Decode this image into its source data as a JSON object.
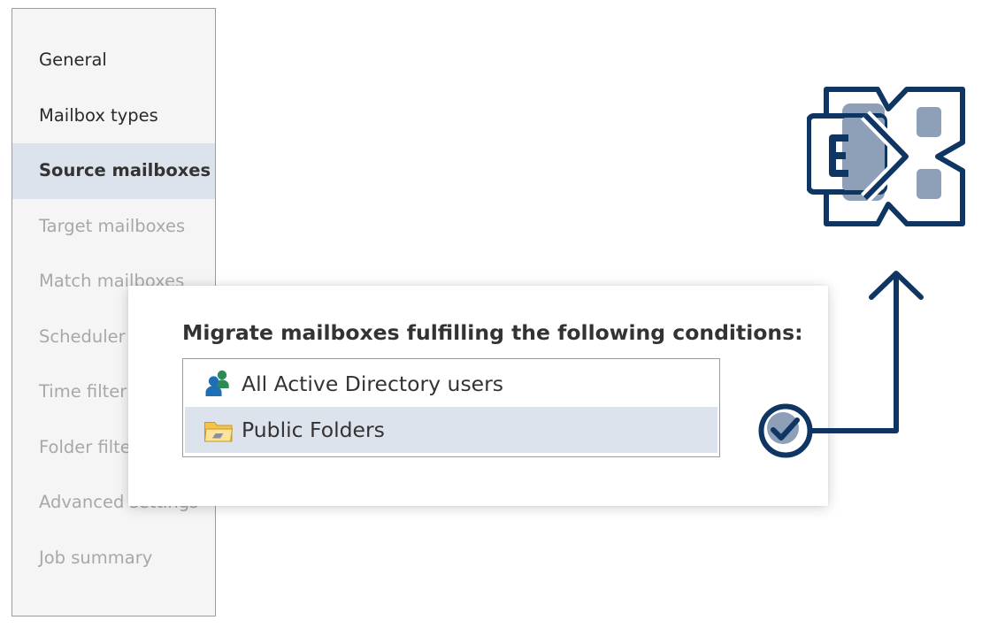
{
  "sidebar": {
    "items": [
      {
        "label": "General",
        "state": "done"
      },
      {
        "label": "Mailbox types",
        "state": "done"
      },
      {
        "label": "Source mailboxes",
        "state": "active"
      },
      {
        "label": "Target mailboxes",
        "state": "pending"
      },
      {
        "label": "Match mailboxes",
        "state": "pending"
      },
      {
        "label": "Scheduler",
        "state": "pending"
      },
      {
        "label": "Time filter",
        "state": "pending"
      },
      {
        "label": "Folder filter",
        "state": "pending"
      },
      {
        "label": "Advanced settings",
        "state": "pending"
      },
      {
        "label": "Job summary",
        "state": "pending"
      }
    ]
  },
  "panel": {
    "title": "Migrate mailboxes fulfilling the following conditions:",
    "options": [
      {
        "label": "All Active Directory users",
        "icon": "users-icon",
        "selected": false
      },
      {
        "label": "Public Folders",
        "icon": "folder-icon",
        "selected": true
      }
    ]
  },
  "colors": {
    "accent_navy": "#0f3562",
    "selection_bg": "#dde3ec",
    "logo_fill": "#8da0b7",
    "inactive_text": "#a8a8a8"
  },
  "graphics": {
    "logo": "exchange-logo",
    "confirmation": "checkmark-circle-icon",
    "connector": "arrow-up-icon"
  }
}
